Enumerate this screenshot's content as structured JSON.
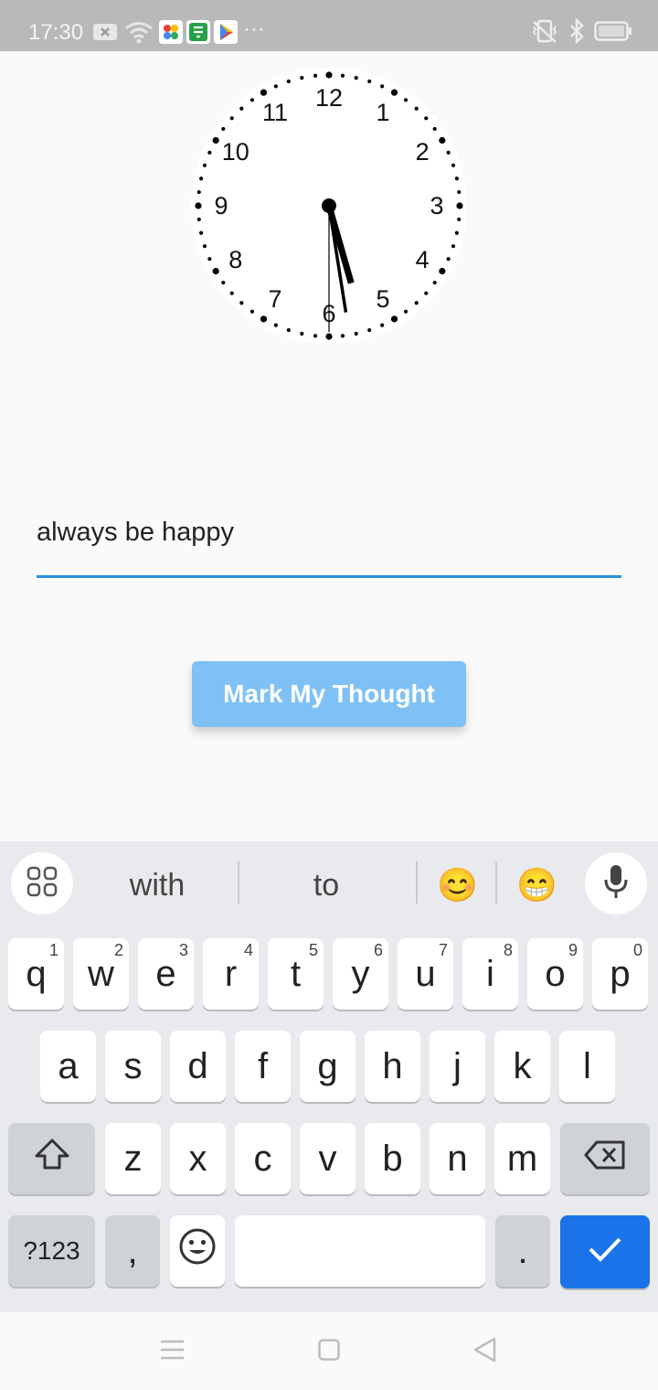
{
  "status_bar": {
    "time": "17:30",
    "icons": [
      "notification-x-icon",
      "wifi-icon",
      "photos-app-icon",
      "store-app-icon",
      "play-store-icon",
      "more-dots-icon",
      "vibrate-icon",
      "bluetooth-icon",
      "battery-icon"
    ],
    "more": "···"
  },
  "clock": {
    "numbers": [
      "12",
      "1",
      "2",
      "3",
      "4",
      "5",
      "6",
      "7",
      "8",
      "9",
      "10",
      "11"
    ],
    "hour": 5,
    "minute": 28,
    "second": 30
  },
  "form": {
    "input_value": "always be happy",
    "accent_color": "#2a8fd6",
    "button_label": "Mark My Thought",
    "button_color": "#7fc1f5"
  },
  "keyboard": {
    "suggestions": [
      "with",
      "to"
    ],
    "emoji": [
      "😊",
      "😁"
    ],
    "row1": [
      {
        "label": "q",
        "hint": "1"
      },
      {
        "label": "w",
        "hint": "2"
      },
      {
        "label": "e",
        "hint": "3"
      },
      {
        "label": "r",
        "hint": "4"
      },
      {
        "label": "t",
        "hint": "5"
      },
      {
        "label": "y",
        "hint": "6"
      },
      {
        "label": "u",
        "hint": "7"
      },
      {
        "label": "i",
        "hint": "8"
      },
      {
        "label": "o",
        "hint": "9"
      },
      {
        "label": "p",
        "hint": "0"
      }
    ],
    "row2": [
      "a",
      "s",
      "d",
      "f",
      "g",
      "h",
      "j",
      "k",
      "l"
    ],
    "row3": [
      "z",
      "x",
      "c",
      "v",
      "b",
      "n",
      "m"
    ],
    "symbols_label": "?123",
    "comma_label": ",",
    "period_label": ".",
    "enter_color": "#1a73e8"
  }
}
